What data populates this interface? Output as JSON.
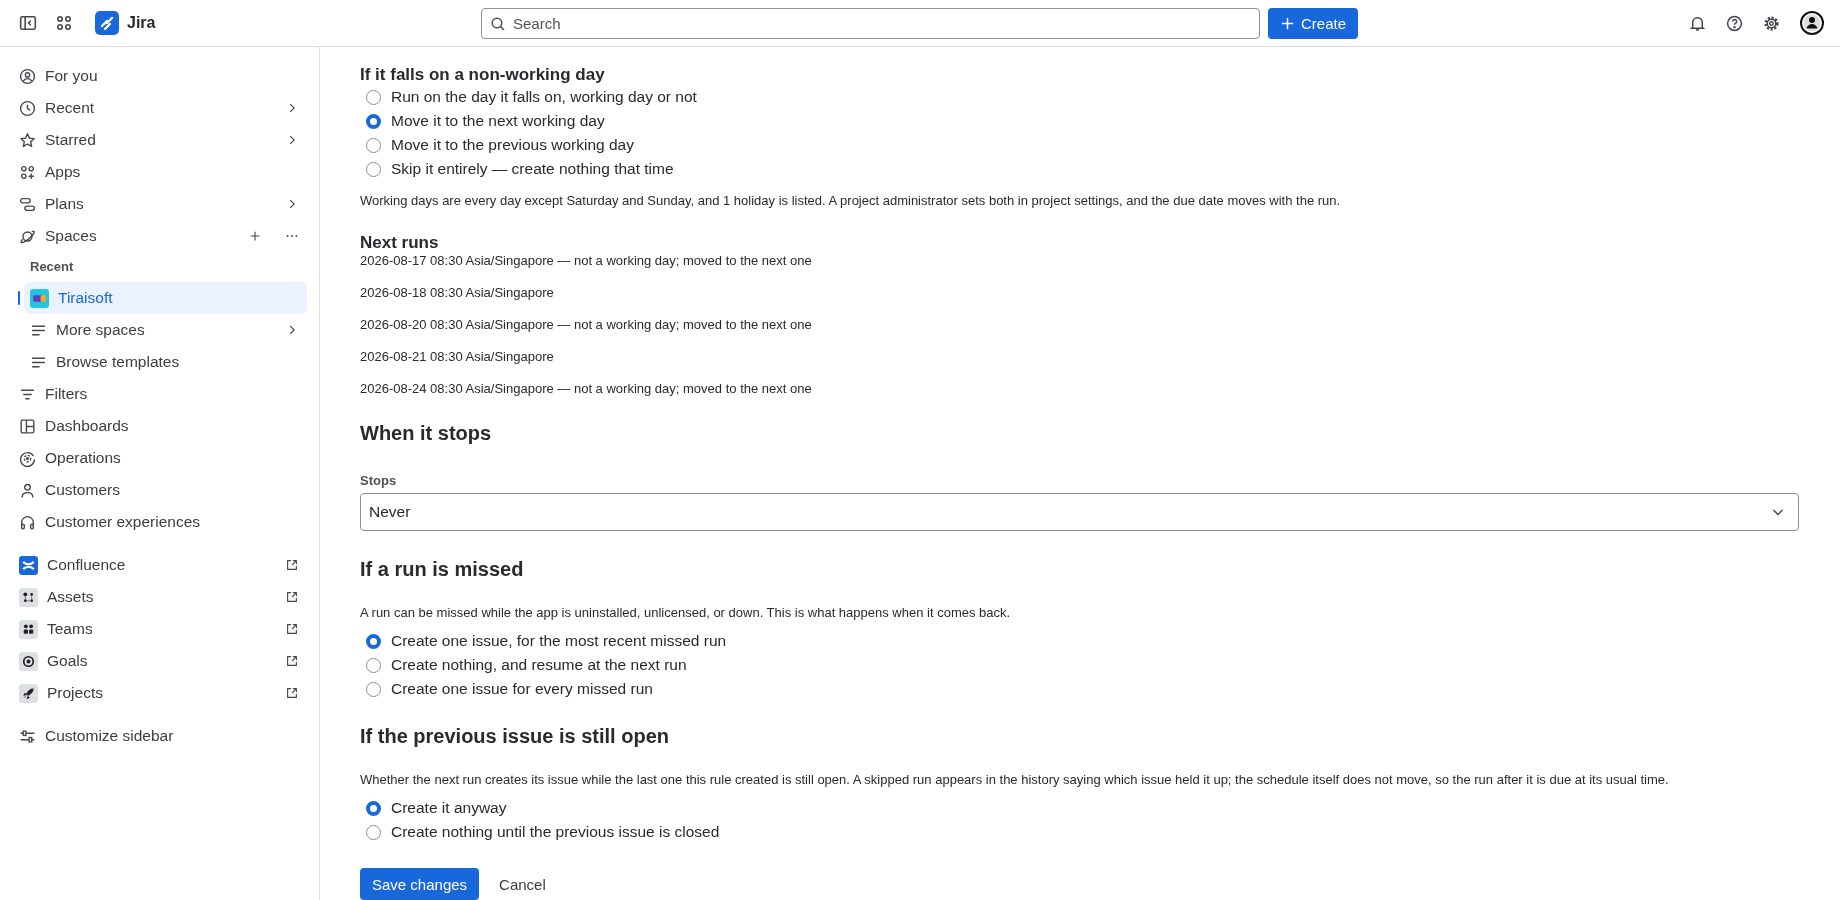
{
  "topbar": {
    "product": "Jira",
    "search": {
      "placeholder": "Search"
    },
    "create_button": "Create"
  },
  "sidebar": {
    "main": [
      {
        "label": "For you",
        "kind": "link",
        "selected": false
      },
      {
        "label": "Recent",
        "kind": "submenu",
        "selected": false
      },
      {
        "label": "Starred",
        "kind": "submenu",
        "selected": false
      },
      {
        "label": "Apps",
        "kind": "link",
        "selected": false
      },
      {
        "label": "Plans",
        "kind": "submenu",
        "selected": false
      },
      {
        "label": "Spaces",
        "kind": "section",
        "selected": false
      }
    ],
    "recent_label": "Recent",
    "spaces": [
      {
        "label": "Tiraisoft",
        "kind": "space",
        "selected": true
      },
      {
        "label": "More spaces",
        "kind": "submenu",
        "selected": false
      },
      {
        "label": "Browse templates",
        "kind": "link",
        "selected": false
      }
    ],
    "more": [
      {
        "label": "Filters",
        "kind": "link",
        "selected": false
      },
      {
        "label": "Dashboards",
        "kind": "link",
        "selected": false
      },
      {
        "label": "Operations",
        "kind": "link",
        "selected": false
      },
      {
        "label": "Customers",
        "kind": "link",
        "selected": false
      },
      {
        "label": "Customer experiences",
        "kind": "link",
        "selected": false
      }
    ],
    "apps": [
      {
        "label": "Confluence",
        "kind": "external",
        "selected": false
      },
      {
        "label": "Assets",
        "kind": "external",
        "selected": false
      },
      {
        "label": "Teams",
        "kind": "external",
        "selected": false
      },
      {
        "label": "Goals",
        "kind": "external",
        "selected": false
      },
      {
        "label": "Projects",
        "kind": "external",
        "selected": false
      }
    ],
    "customize": "Customize sidebar"
  },
  "sections": [
    {
      "kind": "radios_then_note",
      "title": "If it falls on a non-working day",
      "options": [
        {
          "label": "Run on the day it falls on, working day or not",
          "selected": false
        },
        {
          "label": "Move it to the next working day",
          "selected": true
        },
        {
          "label": "Move it to the previous working day",
          "selected": false
        },
        {
          "label": "Skip it entirely — create nothing that time",
          "selected": false
        }
      ],
      "note": "Working days are every day except Saturday and Sunday, and 1 holiday is listed. A project administrator sets both in project settings, and the due date moves with the run."
    },
    {
      "kind": "list",
      "title": "Next runs",
      "items": [
        "2026-08-17 08:30 Asia/Singapore — not a working day; moved to the next one",
        "2026-08-18 08:30 Asia/Singapore",
        "2026-08-20 08:30 Asia/Singapore — not a working day; moved to the next one",
        "2026-08-21 08:30 Asia/Singapore",
        "2026-08-24 08:30 Asia/Singapore — not a working day; moved to the next one"
      ]
    },
    {
      "kind": "select",
      "title": "When it stops",
      "field_label": "Stops",
      "value": "Never"
    },
    {
      "kind": "note_then_radios",
      "title": "If a run is missed",
      "note": "A run can be missed while the app is uninstalled, unlicensed, or down. This is what happens when it comes back.",
      "options": [
        {
          "label": "Create one issue, for the most recent missed run",
          "selected": true
        },
        {
          "label": "Create nothing, and resume at the next run",
          "selected": false
        },
        {
          "label": "Create one issue for every missed run",
          "selected": false
        }
      ]
    },
    {
      "kind": "note_then_radios",
      "title": "If the previous issue is still open",
      "note": "Whether the next run creates its issue while the last one this rule created is still open. A skipped run appears in the history saying which issue held it up; the schedule itself does not move, so the run after it is due at its usual time.",
      "options": [
        {
          "label": "Create it anyway",
          "selected": true
        },
        {
          "label": "Create nothing until the previous issue is closed",
          "selected": false
        }
      ]
    }
  ],
  "actions": {
    "primary": "Save changes",
    "secondary": "Cancel"
  }
}
